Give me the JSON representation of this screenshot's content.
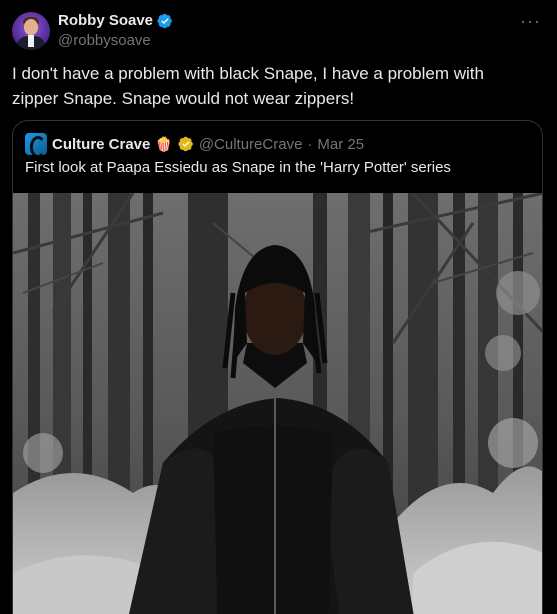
{
  "author": {
    "display_name": "Robby Soave",
    "handle": "@robbysoave",
    "verified": true,
    "avatar_icon": "avatar-photo"
  },
  "more_menu": {
    "label": "···"
  },
  "tweet": {
    "text": "I don't have a problem with black Snape, I have a problem with zipper Snape. Snape would not wear zippers!"
  },
  "quoted_tweet": {
    "display_name": "Culture Crave",
    "emoji": "🍿",
    "verified": true,
    "verified_color": "#e2b719",
    "handle": "@CultureCrave",
    "separator": "·",
    "date": "Mar 25",
    "text": "First look at Paapa Essiedu as Snape in the 'Harry Potter' series",
    "media_icon": "photo-snowy-forest-dark-cloak"
  },
  "colors": {
    "background": "#000000",
    "text_primary": "#e7e9ea",
    "text_secondary": "#71767b",
    "border": "#2f3336",
    "verified_blue": "#1d9bf0"
  }
}
